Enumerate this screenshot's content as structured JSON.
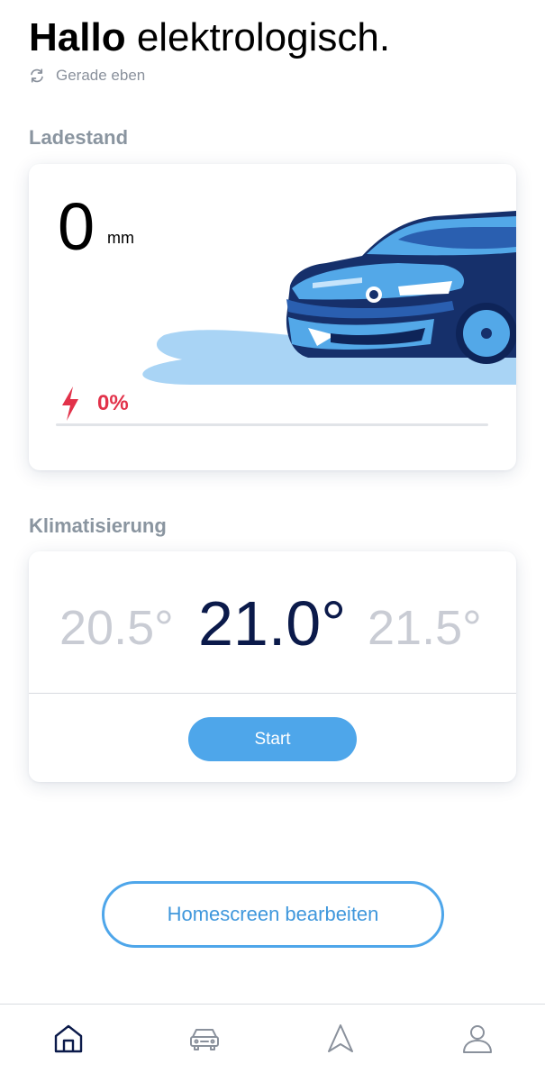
{
  "header": {
    "greeting_bold": "Hallo",
    "greeting_name": "elektrologisch.",
    "refresh_status": "Gerade eben",
    "refresh_icon": "refresh-icon"
  },
  "battery": {
    "section_title": "Ladestand",
    "range_value": "0",
    "range_unit": "mm",
    "charge_percent": "0%",
    "charge_fraction": 0,
    "charge_icon": "lightning-bolt-icon",
    "accent_color": "#e2324a"
  },
  "climate": {
    "section_title": "Klimatisierung",
    "temp_prev": "20.5°",
    "temp_current": "21.0°",
    "temp_next": "21.5°",
    "start_label": "Start"
  },
  "actions": {
    "edit_homescreen_label": "Homescreen bearbeiten"
  },
  "nav": {
    "items": [
      {
        "icon": "home-icon",
        "active": true
      },
      {
        "icon": "car-icon",
        "active": false
      },
      {
        "icon": "navigation-arrow-icon",
        "active": false
      },
      {
        "icon": "profile-icon",
        "active": false
      }
    ],
    "active_color": "#0b1a4a",
    "inactive_color": "#8a919c"
  },
  "colors": {
    "primary_blue": "#4ea6ea",
    "dark_navy": "#0b1a4a"
  }
}
